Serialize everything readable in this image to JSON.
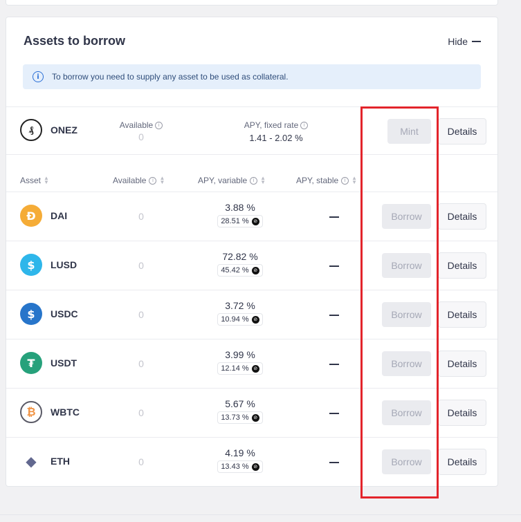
{
  "header": {
    "title": "Assets to borrow",
    "hide_label": "Hide"
  },
  "banner": {
    "text": "To borrow you need to supply any asset to be used as collateral."
  },
  "onez": {
    "symbol": "ONEZ",
    "available_label": "Available",
    "available_value": "0",
    "apy_label": "APY, fixed rate",
    "apy_value": "1.41 - 2.02 %",
    "mint_label": "Mint",
    "details_label": "Details"
  },
  "columns": {
    "asset": "Asset",
    "available": "Available",
    "apy_variable": "APY, variable",
    "apy_stable": "APY, stable"
  },
  "rows": [
    {
      "symbol": "DAI",
      "available": "0",
      "apy": "3.88 %",
      "incentive": "28.51 %",
      "stable": "—",
      "borrow": "Borrow",
      "details": "Details",
      "color": "#f5ac37"
    },
    {
      "symbol": "LUSD",
      "available": "0",
      "apy": "72.82 %",
      "incentive": "45.42 %",
      "stable": "—",
      "borrow": "Borrow",
      "details": "Details",
      "color": "#2eb6ea"
    },
    {
      "symbol": "USDC",
      "available": "0",
      "apy": "3.72 %",
      "incentive": "10.94 %",
      "stable": "—",
      "borrow": "Borrow",
      "details": "Details",
      "color": "#2775ca"
    },
    {
      "symbol": "USDT",
      "available": "0",
      "apy": "3.99 %",
      "incentive": "12.14 %",
      "stable": "—",
      "borrow": "Borrow",
      "details": "Details",
      "color": "#26a17b"
    },
    {
      "symbol": "WBTC",
      "available": "0",
      "apy": "5.67 %",
      "incentive": "13.73 %",
      "stable": "—",
      "borrow": "Borrow",
      "details": "Details",
      "color": "#f09242"
    },
    {
      "symbol": "ETH",
      "available": "0",
      "apy": "4.19 %",
      "incentive": "13.43 %",
      "stable": "—",
      "borrow": "Borrow",
      "details": "Details",
      "color": "#62688f"
    }
  ],
  "icons": {
    "info": "info-circle-icon",
    "sort": "sort-arrows-icon",
    "reward": "reward-token-icon"
  },
  "colors": {
    "highlight": "#e3242b",
    "banner_bg": "#e5effb",
    "banner_icon": "#2a6fd6"
  }
}
